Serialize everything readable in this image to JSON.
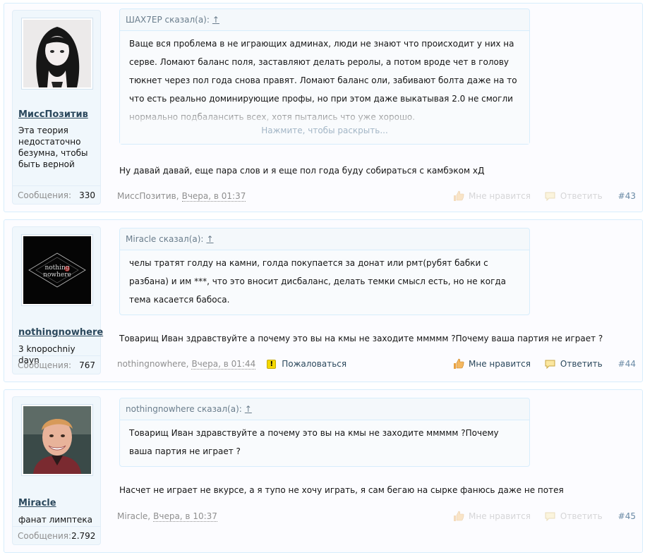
{
  "posts": [
    {
      "username": "МиссПозитив",
      "user_title": "Эта теория недостаточно безумна, чтобы быть верной",
      "messages_label": "Сообщения:",
      "messages_count": "330",
      "quote_author": "ШАХ7ЕР сказал(а):",
      "quote_arrow": "↑",
      "quote_text": "Ваще вся проблема в не играющих админах, люди не знают что происходит у них на серве. Ломают баланс поля, заставляют делать реролы, а потом вроде чет в голову тюкнет через пол года снова правят. Ломают баланс оли, забивают болта даже на то что есть реально доминирующие профы, но при этом даже выкатывая 2.0 не смогли нормально подбалансить всех, хотя пытались что уже хорошо.",
      "expand_label": "Нажмите, чтобы раскрыть...",
      "reply": "Ну давай давай, еще пара слов и я еще пол года буду собираться с камбэком хД",
      "author": "МиссПозитив",
      "date": "Вчера, в 01:37",
      "report": "",
      "like_label": "Мне нравится",
      "reply_label": "Ответить",
      "post_number": "#43"
    },
    {
      "username": "nothingnowhere",
      "user_title": "3 knopochniy dayn",
      "messages_label": "Сообщения:",
      "messages_count": "767",
      "quote_author": "Miracle сказал(а):",
      "quote_arrow": "↑",
      "quote_text": "челы тратят голду на камни, голда покупается за донат или рмт(рубят бабки с разбана) и им ***, что это вносит дисбаланс, делать темки смысл есть, но не когда тема касается бабоса.",
      "expand_label": "",
      "reply": "Товарищ Иван здравствуйте а почему это вы на кмы не заходите ммммм ?Почему ваша партия не играет ?",
      "author": "nothingnowhere",
      "date": "Вчера, в 01:44",
      "report": "Пожаловаться",
      "like_label": "Мне нравится",
      "reply_label": "Ответить",
      "post_number": "#44"
    },
    {
      "username": "Miracle",
      "user_title": "фанат лимптека",
      "messages_label": "Сообщения:",
      "messages_count": "2.792",
      "quote_author": "nothingnowhere сказал(а):",
      "quote_arrow": "↑",
      "quote_text": "Товарищ Иван здравствуйте а почему это вы на кмы не заходите ммммм ?Почему ваша партия не играет ?",
      "expand_label": "",
      "reply": "Насчет не играет не вкурсе, а я тупо не хочу играть, я сам бегаю на сырке фанюсь даже не потея",
      "author": "Miracle",
      "date": "Вчера, в 10:37",
      "report": "",
      "like_label": "Мне нравится",
      "reply_label": "Ответить",
      "post_number": "#45"
    }
  ],
  "avatar2_text": [
    "nothing",
    "nowhere"
  ],
  "colors": {
    "link": "#2b485c",
    "muted": "#8f8f8f",
    "border": "#d7edfc",
    "post_number": "#6a8aa5"
  }
}
